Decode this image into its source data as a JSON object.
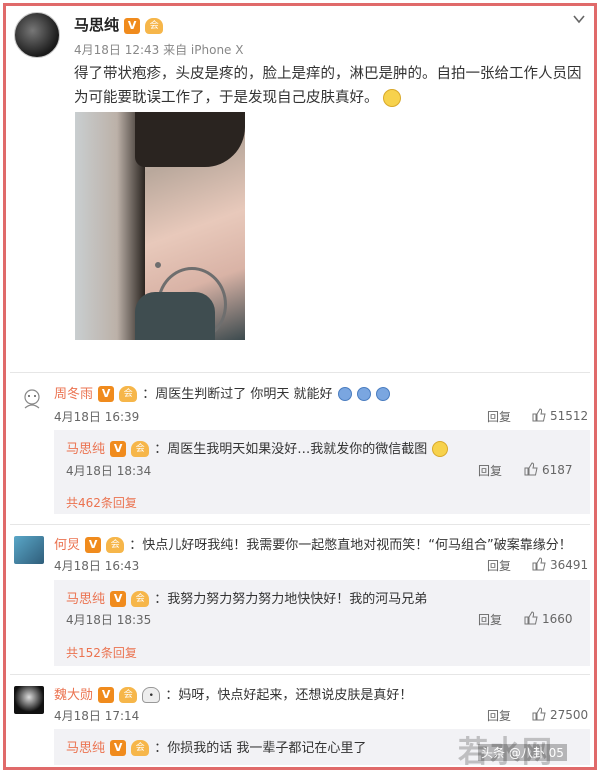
{
  "post": {
    "author": "马思纯",
    "vip_badge": "V",
    "member_badge": "会",
    "meta": "4月18日 12:43 来自 iPhone X",
    "text": "得了带状疱疹，头皮是疼的，脸上是痒的，淋巴是肿的。自拍一张给工作人员因为可能要耽误工作了，于是发现自己皮肤真好。",
    "icons": {
      "menu": "chevron-down-icon",
      "emoji": "smile-emoji-icon",
      "photo": "selfie-photo"
    }
  },
  "comments": [
    {
      "name": "周冬雨",
      "text": "：周医生判断过了 你明天 就能好",
      "date": "4月18日 16:39",
      "reply_label": "回复",
      "likes": "51512",
      "reply": {
        "name": "马思纯",
        "text": "：周医生我明天如果没好…我就发你的微信截图",
        "date": "4月18日 18:34",
        "reply_label": "回复",
        "likes": "6187"
      },
      "more": "共462条回复"
    },
    {
      "name": "何炅",
      "text": "：快点儿好呀我纯！我需要你一起憋直地对视而笑！“何马组合”破案靠缘分！",
      "date": "4月18日 16:43",
      "reply_label": "回复",
      "likes": "36491",
      "reply": {
        "name": "马思纯",
        "text": "：我努力努力努力努力地快快好！我的河马兄弟",
        "date": "4月18日 18:35",
        "reply_label": "回复",
        "likes": "1660"
      },
      "more": "共152条回复"
    },
    {
      "name": "魏大勋",
      "text": "：妈呀，快点好起来，还想说皮肤是真好！",
      "date": "4月18日 17:14",
      "reply_label": "回复",
      "likes": "27500",
      "reply": {
        "name": "马思纯",
        "text": "：你损我的话 我一辈子都记在心里了"
      }
    }
  ],
  "watermark": {
    "brand": "若水网",
    "caption": "头条 @八卦 05"
  },
  "colors": {
    "frame": "#e06a6a",
    "username": "#eb7350",
    "vip": "#f08b1d"
  }
}
